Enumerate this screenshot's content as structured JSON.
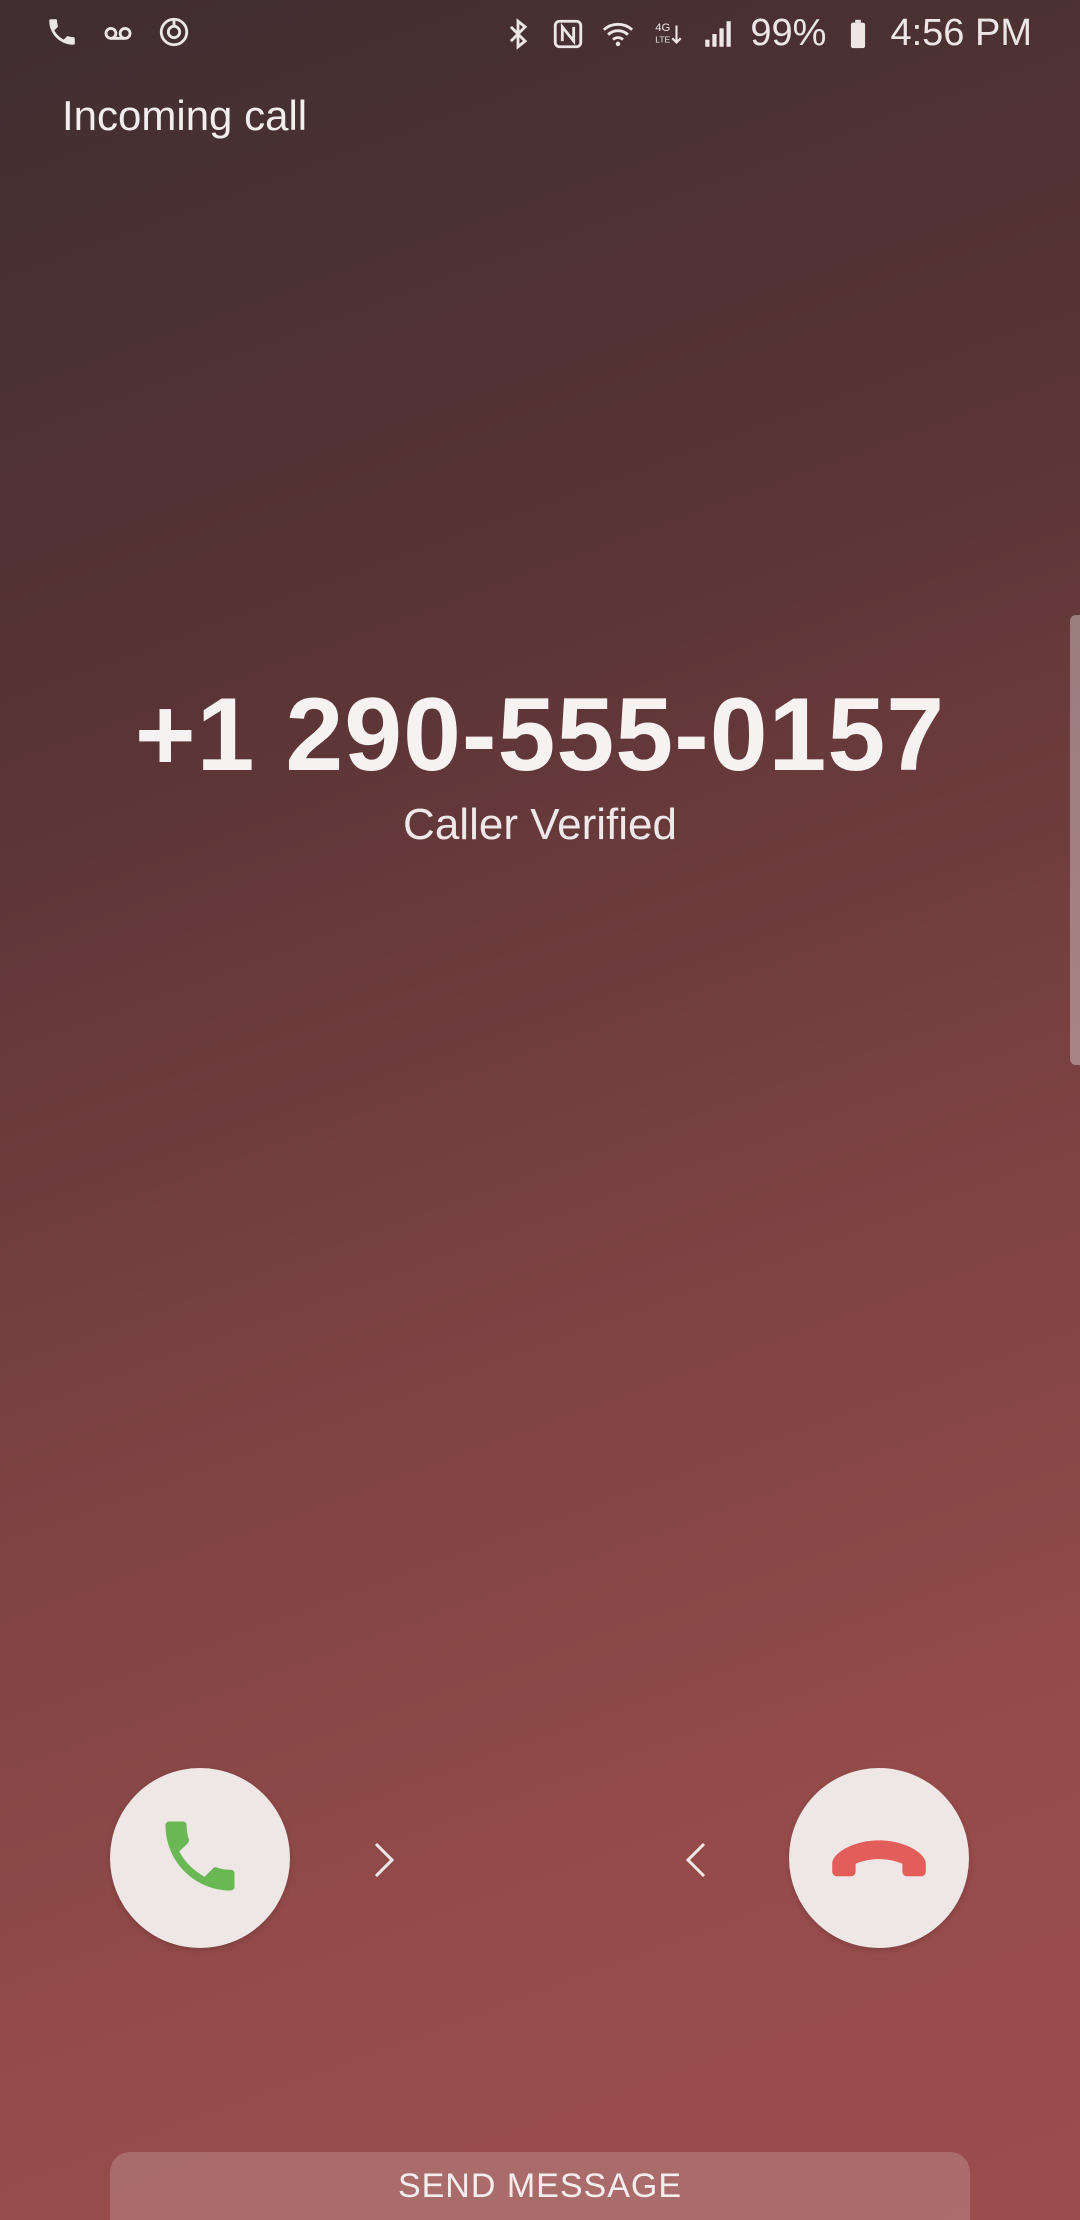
{
  "status_bar": {
    "left_icons": [
      "phone-icon",
      "voicemail-icon",
      "sync-icon"
    ],
    "right_icons": [
      "bluetooth-icon",
      "nfc-icon",
      "wifi-icon",
      "4g-lte-icon",
      "signal-icon",
      "battery-icon"
    ],
    "battery_percent": "99%",
    "time": "4:56 PM"
  },
  "header": {
    "title": "Incoming call"
  },
  "caller": {
    "number": "+1 290-555-0157",
    "status": "Caller Verified"
  },
  "actions": {
    "accept_icon": "phone-accept-icon",
    "decline_icon": "phone-decline-icon",
    "accept_color": "#6ab854",
    "decline_color": "#e35d5b",
    "button_bg": "#efe6e6"
  },
  "footer": {
    "send_message_label": "SEND MESSAGE"
  }
}
